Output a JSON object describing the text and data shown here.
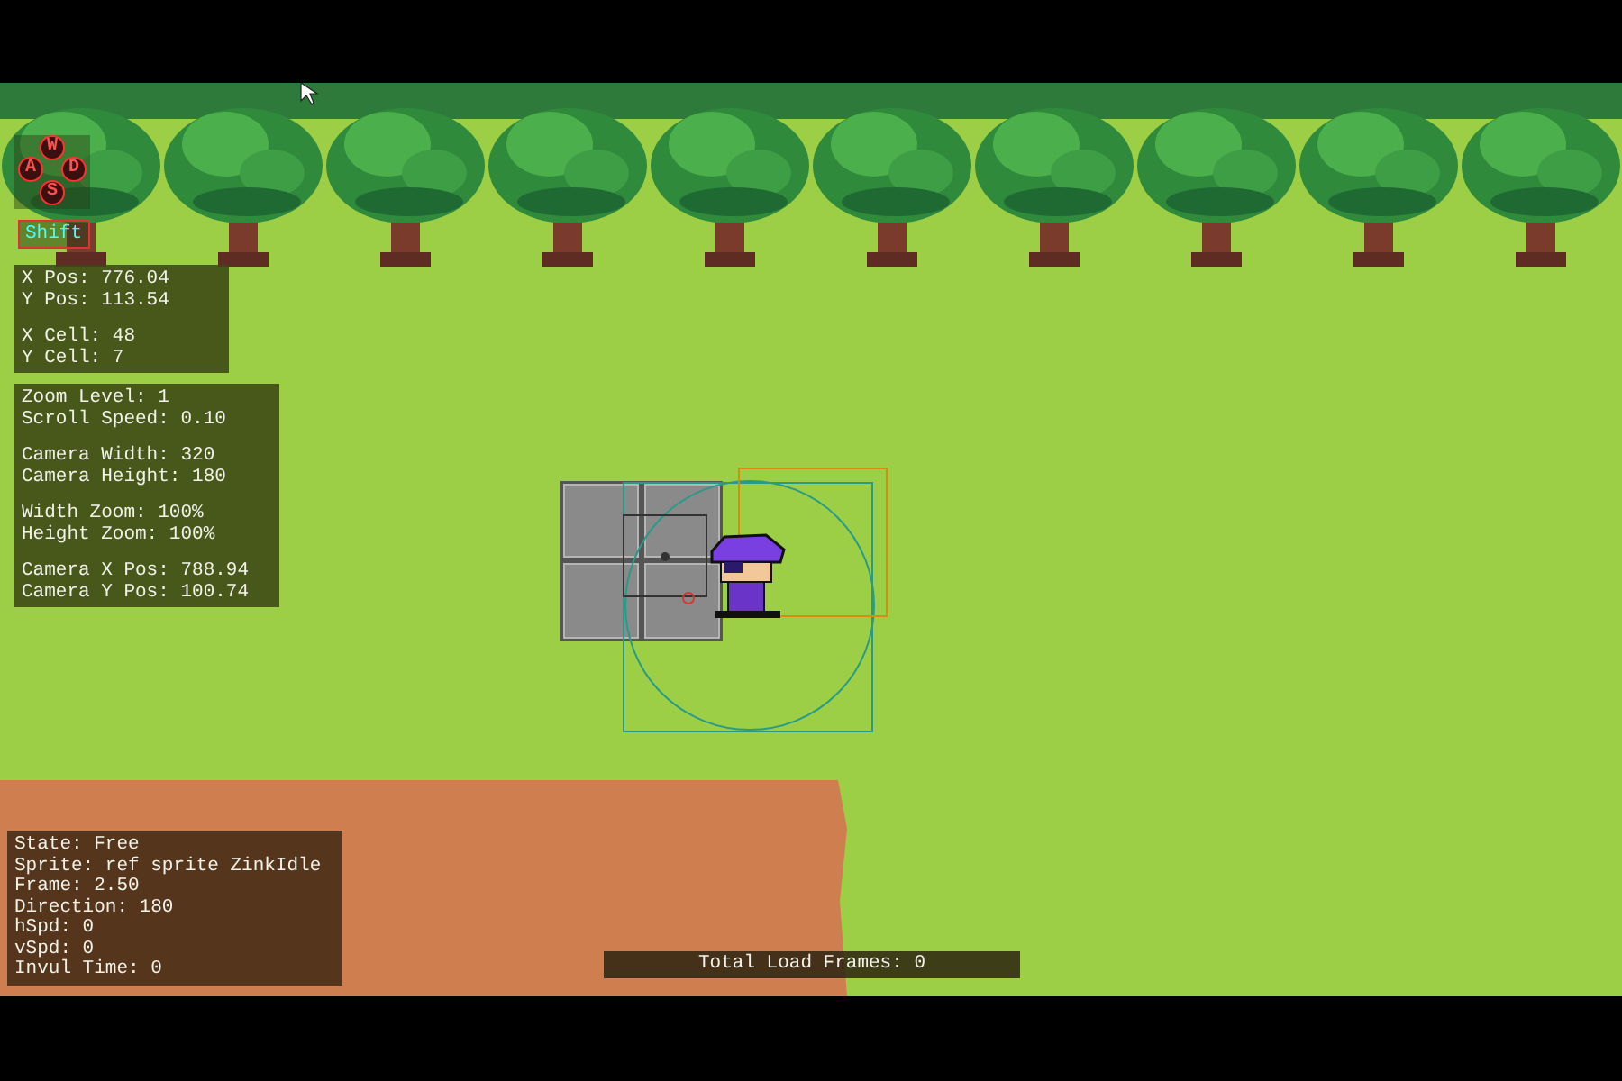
{
  "keys": [
    {
      "label": "W",
      "pressed": false
    },
    {
      "label": "A",
      "pressed": false
    },
    {
      "label": "D",
      "pressed": false
    },
    {
      "label": "S",
      "pressed": false
    }
  ],
  "shift_key": {
    "label": "Shift"
  },
  "position_panel": {
    "groups": [
      [
        "X Pos: 776.04",
        "Y Pos: 113.54"
      ],
      [
        "X Cell: 48",
        "Y Cell: 7"
      ]
    ]
  },
  "camera_panel": {
    "groups": [
      [
        "Zoom Level: 1",
        "Scroll Speed: 0.10"
      ],
      [
        "Camera Width: 320",
        "Camera Height: 180"
      ],
      [
        "Width Zoom: 100%",
        "Height Zoom: 100%"
      ],
      [
        "Camera X Pos: 788.94",
        "Camera Y Pos: 100.74"
      ]
    ]
  },
  "state_panel": {
    "groups": [
      [
        "State: Free",
        "Sprite: ref sprite ZinkIdle",
        "Frame: 2.50",
        "Direction: 180",
        "hSpd: 0",
        "vSpd: 0",
        "Invul Time: 0"
      ]
    ]
  },
  "load_bar": {
    "label": "Total Load Frames: 0"
  }
}
